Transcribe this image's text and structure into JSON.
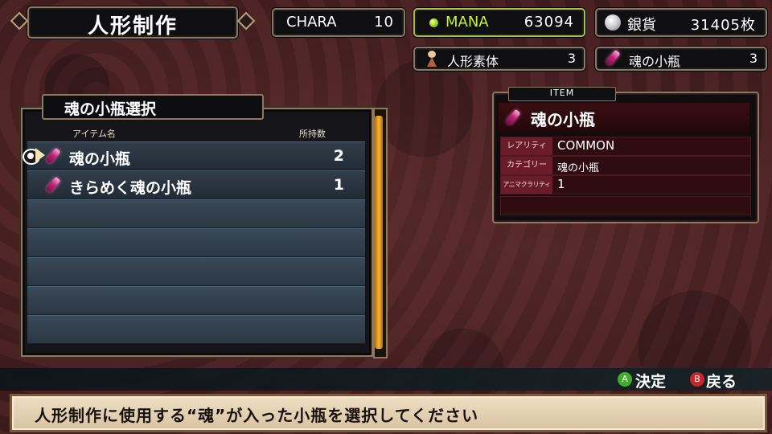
{
  "header": {
    "title": "人形制作"
  },
  "stats": {
    "chara": {
      "label": "CHARA",
      "value": "10"
    },
    "mana": {
      "label": "MANA",
      "value": "63094",
      "color": "#c6ee3e"
    },
    "silver": {
      "label": "銀貨",
      "value": "31405枚"
    },
    "doll_material": {
      "label": "人形素体",
      "value": "3"
    },
    "soul_vial": {
      "label": "魂の小瓶",
      "value": "3"
    }
  },
  "list": {
    "title": "魂の小瓶選択",
    "columns": {
      "name": "アイテム名",
      "count": "所持数"
    },
    "items": [
      {
        "name": "魂の小瓶",
        "count": "2",
        "icon": "soul-vial-icon",
        "selected": true
      },
      {
        "name": "きらめく魂の小瓶",
        "count": "1",
        "icon": "soul-vial-icon",
        "selected": false
      }
    ]
  },
  "item_detail": {
    "tab": "ITEM",
    "name": "魂の小瓶",
    "rows": [
      {
        "label": "レアリティ",
        "value": "COMMON"
      },
      {
        "label": "カテゴリー",
        "value": "魂の小瓶"
      },
      {
        "label": "アニマクラリティ",
        "value": "1"
      }
    ]
  },
  "controls": {
    "confirm": {
      "button": "A",
      "label": "決定"
    },
    "back": {
      "button": "B",
      "label": "戻る"
    }
  },
  "message": "人形制作に使用する“魂”が入った小瓶を選択してください"
}
